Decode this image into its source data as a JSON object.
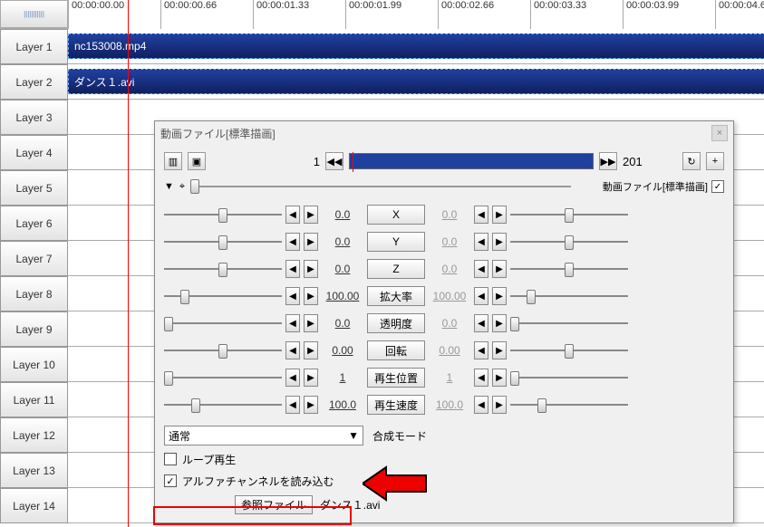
{
  "ruler": {
    "times": [
      "00:00:00.00",
      "00:00:00.66",
      "00:00:01.33",
      "00:00:01.99",
      "00:00:02.66",
      "00:00:03.33",
      "00:00:03.99",
      "00:00:04.6"
    ]
  },
  "layers": [
    {
      "label": "Layer 1",
      "clip": "nc153008.mp4",
      "clip_start": 0,
      "clip_width": 770
    },
    {
      "label": "Layer 2",
      "clip": "ダンス１.avi",
      "clip_start": 0,
      "clip_width": 770
    },
    {
      "label": "Layer 3"
    },
    {
      "label": "Layer 4"
    },
    {
      "label": "Layer 5"
    },
    {
      "label": "Layer 6"
    },
    {
      "label": "Layer 7"
    },
    {
      "label": "Layer 8"
    },
    {
      "label": "Layer 9"
    },
    {
      "label": "Layer 10"
    },
    {
      "label": "Layer 11"
    },
    {
      "label": "Layer 12"
    },
    {
      "label": "Layer 13"
    },
    {
      "label": "Layer 14"
    }
  ],
  "dialog": {
    "title": "動画ファイル[標準描画]",
    "frame_start": "1",
    "frame_end": "201",
    "section_label": "動画ファイル[標準描画]",
    "section_checked": true,
    "params": [
      {
        "name": "X",
        "left": "0.0",
        "right": "0.0",
        "thumb": 60,
        "right_dim": true
      },
      {
        "name": "Y",
        "left": "0.0",
        "right": "0.0",
        "thumb": 60,
        "right_dim": true
      },
      {
        "name": "Z",
        "left": "0.0",
        "right": "0.0",
        "thumb": 60,
        "right_dim": true
      },
      {
        "name": "拡大率",
        "left": "100.00",
        "right": "100.00",
        "thumb": 18,
        "right_dim": true
      },
      {
        "name": "透明度",
        "left": "0.0",
        "right": "0.0",
        "thumb": 0,
        "right_dim": true
      },
      {
        "name": "回転",
        "left": "0.00",
        "right": "0.00",
        "thumb": 60,
        "right_dim": true
      },
      {
        "name": "再生位置",
        "left": "1",
        "right": "1",
        "thumb": 0,
        "right_dim": true
      },
      {
        "name": "再生速度",
        "left": "100.0",
        "right": "100.0",
        "thumb": 30,
        "right_dim": true
      }
    ],
    "blend_mode_label": "合成モード",
    "blend_mode_value": "通常",
    "loop_label": "ループ再生",
    "loop_checked": false,
    "alpha_label": "アルファチャンネルを読み込む",
    "alpha_checked": true,
    "ref_file_label": "参照ファイル",
    "ref_file_value": "ダンス１.avi"
  }
}
